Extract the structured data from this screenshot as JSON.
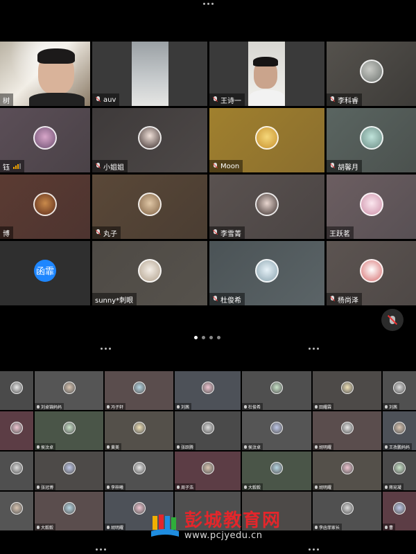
{
  "main_grid": {
    "participants": [
      {
        "name": "树",
        "muted": false,
        "type": "camera"
      },
      {
        "name": "auv",
        "muted": true,
        "type": "camera"
      },
      {
        "name": "王诗一",
        "muted": true,
        "type": "camera"
      },
      {
        "name": "李科睿",
        "muted": true,
        "type": "avatar"
      },
      {
        "name": "钰",
        "muted": false,
        "type": "avatar",
        "signal": true
      },
      {
        "name": "小姐姐",
        "muted": true,
        "type": "avatar"
      },
      {
        "name": "Moon",
        "muted": true,
        "type": "avatar"
      },
      {
        "name": "胡馨月",
        "muted": true,
        "type": "avatar"
      },
      {
        "name": "博",
        "muted": false,
        "type": "avatar"
      },
      {
        "name": "丸子",
        "muted": true,
        "type": "avatar"
      },
      {
        "name": "李雪菁",
        "muted": true,
        "type": "avatar"
      },
      {
        "name": "王跃茗",
        "muted": false,
        "type": "avatar"
      },
      {
        "name": "",
        "muted": false,
        "type": "letter",
        "letter": "函霏"
      },
      {
        "name": "sunny*刺眼",
        "muted": false,
        "type": "avatar"
      },
      {
        "name": "杜俊希",
        "muted": true,
        "type": "avatar"
      },
      {
        "name": "杨尚泽",
        "muted": true,
        "type": "avatar"
      }
    ]
  },
  "small_grid": {
    "rows": [
      [
        "",
        "刘卓锦妈妈",
        "冯子轩",
        "刘茜",
        "杜俊希",
        "田耀霖",
        "刘茜"
      ],
      [
        "",
        "侯汶卓",
        "黄美",
        "张跃腾",
        "侯汶卓",
        "胡明耀",
        "王孜鹏妈妈"
      ],
      [
        "",
        "张冠博",
        "李梓曦",
        "周子浩",
        "大毅毅",
        "胡明耀",
        "蒋宛凝"
      ],
      [
        "",
        "大毅毅",
        "胡明耀",
        "",
        "",
        "李函菲家长",
        "曹"
      ]
    ]
  },
  "watermark": {
    "title": "彭城教育网",
    "url": "www.pcjyedu.cn"
  },
  "colors": {
    "letter_avatar": "#1e86ff",
    "watermark_red": "#e4262b",
    "signal": "#f0a400",
    "muted_slash": "#ee3333"
  }
}
